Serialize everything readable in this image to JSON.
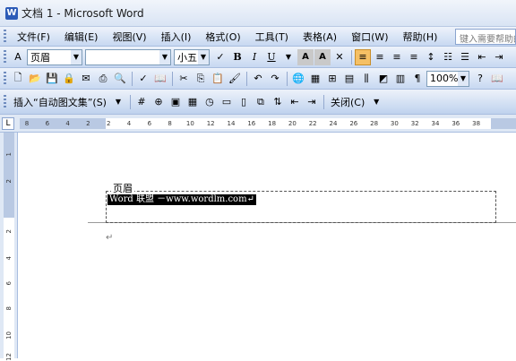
{
  "window": {
    "title": "文档 1 - Microsoft Word"
  },
  "menubar": {
    "items": [
      "文件(F)",
      "编辑(E)",
      "视图(V)",
      "插入(I)",
      "格式(O)",
      "工具(T)",
      "表格(A)",
      "窗口(W)",
      "帮助(H)"
    ],
    "help_placeholder": "键入需要帮助的"
  },
  "formatting": {
    "style": "页眉",
    "font_size": "小五",
    "bold": "B",
    "italic": "I",
    "underline": "U"
  },
  "standard": {
    "zoom": "100%"
  },
  "header_footer_toolbar": {
    "insert_autotext": "插入“自动图文集”(S)",
    "close": "关闭(C)"
  },
  "ruler": {
    "ticks": [
      "8",
      "6",
      "4",
      "2",
      "2",
      "4",
      "6",
      "8",
      "10",
      "12",
      "14",
      "16",
      "18",
      "20",
      "22",
      "24",
      "26",
      "28",
      "30",
      "32",
      "34",
      "36",
      "38"
    ],
    "vticks": [
      "1",
      "2",
      "2",
      "4",
      "6",
      "8",
      "10",
      "12"
    ]
  },
  "document": {
    "header_label": "页眉",
    "header_text": "Word 联盟 －www.wordlm.com↵",
    "return_mark": "↵"
  }
}
